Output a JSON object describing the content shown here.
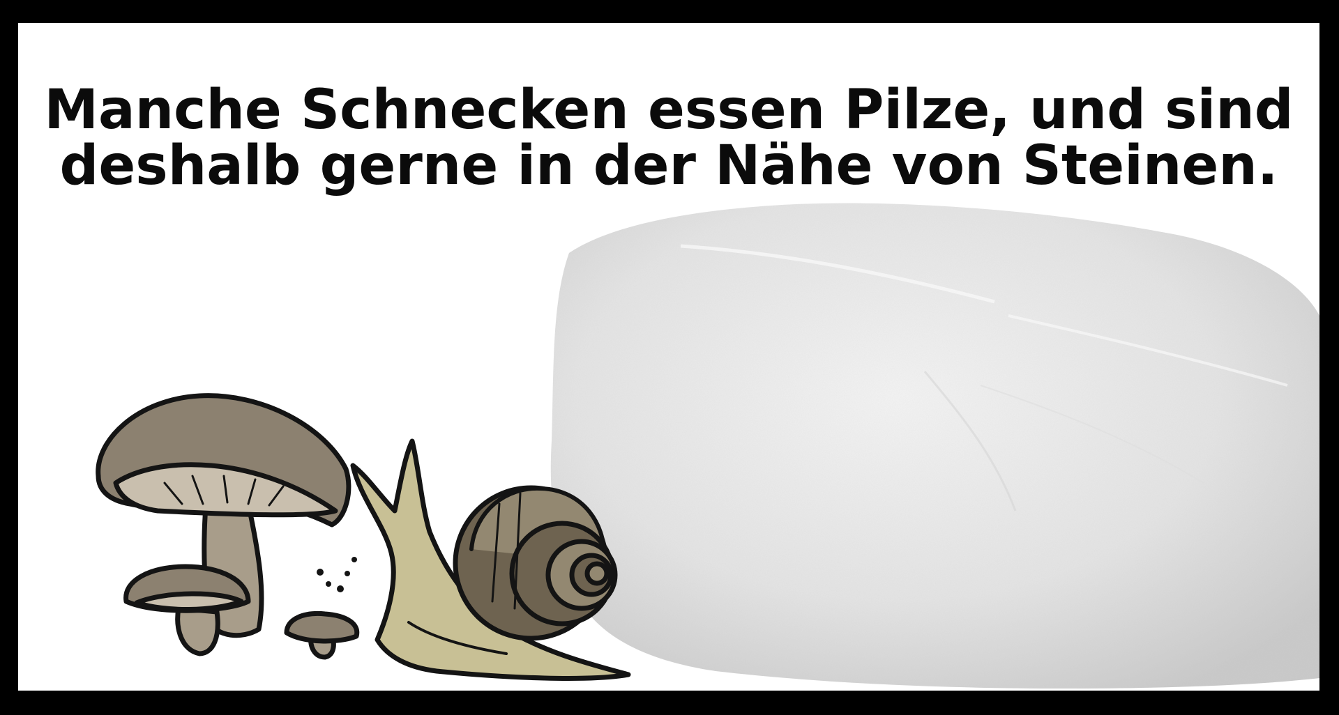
{
  "caption": {
    "line1": "Manche Schnecken essen Pilze, und sind",
    "line2": "deshalb gerne in der Nähe von Steinen."
  },
  "illustration": {
    "elements": [
      "mushroom-group",
      "snail",
      "rock"
    ],
    "icons": {
      "mushrooms": "mushroom-icon",
      "snail": "snail-icon",
      "rock": "rock-icon"
    }
  },
  "colors": {
    "frame": "#000000",
    "background": "#ffffff",
    "text": "#0b0b0b",
    "mushroom_cap": "#8c8170",
    "mushroom_gills": "#c9bfae",
    "mushroom_stem": "#a89d8a",
    "snail_body": "#c8c095",
    "snail_shell_dark": "#6e6350",
    "snail_shell_light": "#938871",
    "rock": "#e9e9e9",
    "rock_shade": "#d2d2d2"
  }
}
